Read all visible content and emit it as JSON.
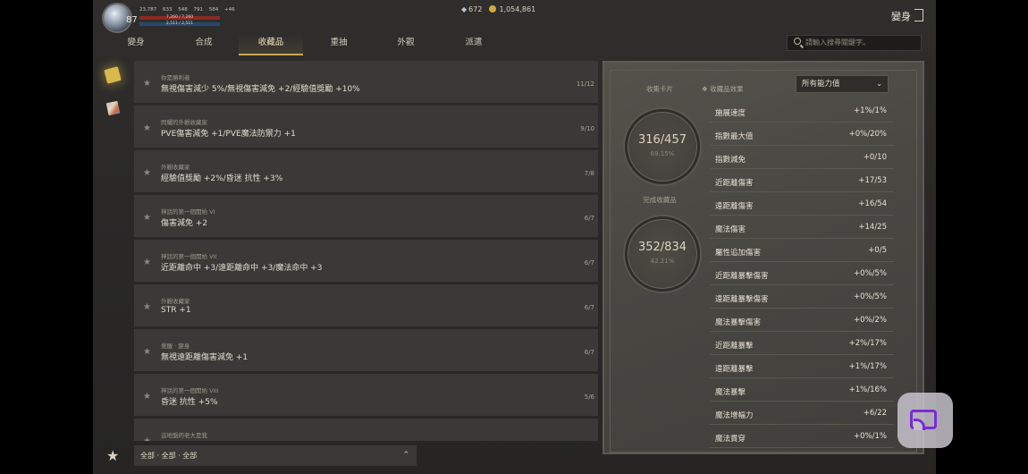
{
  "player": {
    "level": "87",
    "stats": [
      "23,787",
      "633",
      "548",
      "791",
      "584",
      "+46"
    ],
    "hp": "7,260 / 7,260",
    "mp": "2,511 / 2,511"
  },
  "currency": {
    "gems": "672",
    "gold": "1,054,861"
  },
  "header": {
    "transform_label": "變身"
  },
  "tabs": [
    {
      "label": "變身"
    },
    {
      "label": "合成"
    },
    {
      "label": "收藏品"
    },
    {
      "label": "重抽"
    },
    {
      "label": "外觀"
    },
    {
      "label": "派遣"
    }
  ],
  "search": {
    "placeholder": "請輸入搜尋關鍵字。"
  },
  "collections": [
    {
      "category": "你是勝利者",
      "desc": "無視傷害減少 5%/無視傷害減免 +2/經驗值獎勵 +10%",
      "count": "11/12"
    },
    {
      "category": "閃耀的外觀收藏家",
      "desc": "PVE傷害減免 +1/PVE魔法防禦力 +1",
      "count": "9/10"
    },
    {
      "category": "外觀收藏家",
      "desc": "經驗值獎勵 +2%/昏迷 抗性 +3%",
      "count": "7/8"
    },
    {
      "category": "神話的第一個開始 VI",
      "desc": "傷害減免 +2",
      "count": "6/7"
    },
    {
      "category": "神話的第一個開始 VII",
      "desc": "近距離命中 +3/遠距離命中 +3/魔法命中 +3",
      "count": "6/7"
    },
    {
      "category": "外觀收藏家",
      "desc": "STR +1",
      "count": "6/7"
    },
    {
      "category": "覺醒 · 變身",
      "desc": "無視遠距離傷害減免 +1",
      "count": "6/7"
    },
    {
      "category": "神話的第一個開始 VIII",
      "desc": "昏迷 抗性 +5%",
      "count": "5/6"
    },
    {
      "category": "這地盤的老大是我",
      "desc": "",
      "count": ""
    }
  ],
  "filter": {
    "label": "全部 · 全部 · 全部"
  },
  "summary": {
    "cards_label": "收集卡片",
    "cards_value": "316/457",
    "cards_pct": "69.15%",
    "complete_label": "完成收藏品",
    "complete_value": "352/834",
    "complete_pct": "42.21%",
    "effects_title": "收藏品效果",
    "dropdown_value": "所有能力值"
  },
  "effects": [
    {
      "name": "施展速度",
      "value": "+1%/1%"
    },
    {
      "name": "指數最大值",
      "value": "+0%/20%"
    },
    {
      "name": "指數減免",
      "value": "+0/10"
    },
    {
      "name": "近距離傷害",
      "value": "+17/53"
    },
    {
      "name": "遠距離傷害",
      "value": "+16/54"
    },
    {
      "name": "魔法傷害",
      "value": "+14/25"
    },
    {
      "name": "屬性追加傷害",
      "value": "+0/5"
    },
    {
      "name": "近距離暴擊傷害",
      "value": "+0%/5%"
    },
    {
      "name": "遠距離暴擊傷害",
      "value": "+0%/5%"
    },
    {
      "name": "魔法暴擊傷害",
      "value": "+0%/2%"
    },
    {
      "name": "近距離暴擊",
      "value": "+2%/17%"
    },
    {
      "name": "遠距離暴擊",
      "value": "+1%/17%"
    },
    {
      "name": "魔法暴擊",
      "value": "+1%/16%"
    },
    {
      "name": "魔法增幅力",
      "value": "+6/22"
    },
    {
      "name": "魔法貫穿",
      "value": "+0%/1%"
    }
  ],
  "colors": {
    "accent_gold": "#c9a65a",
    "hp": "#8c2a25",
    "mp": "#27496e",
    "cast": "#7b2bd8"
  }
}
